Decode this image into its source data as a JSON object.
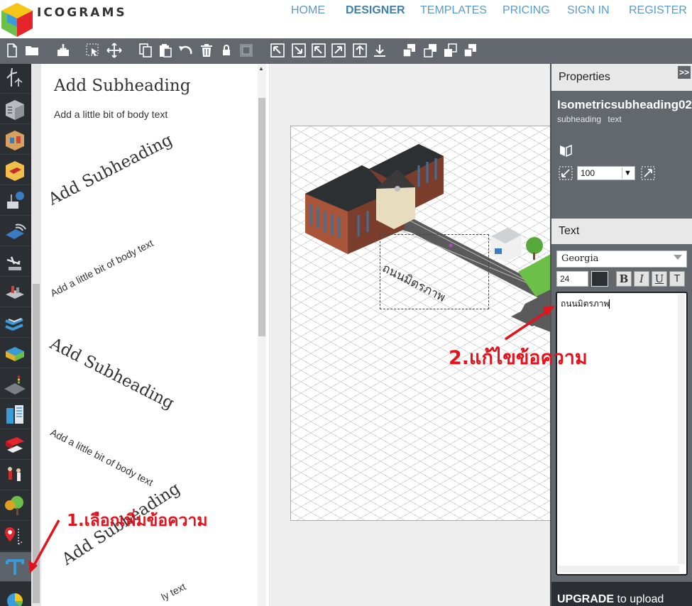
{
  "brand": {
    "name": "ICOGRAMS",
    "colors": [
      "#e5242b",
      "#f5c518",
      "#3a9bd9",
      "#6cc04a"
    ]
  },
  "nav": {
    "items": [
      {
        "label": "HOME",
        "active": false
      },
      {
        "label": "DESIGNER",
        "active": true
      },
      {
        "label": "TEMPLATES",
        "active": false
      },
      {
        "label": "PRICING",
        "active": false
      },
      {
        "label": "SIGN IN",
        "active": false
      },
      {
        "label": "REGISTER",
        "active": false
      }
    ],
    "link_color": "#5a9ac8"
  },
  "toolbar": {
    "icons": [
      "new-file-icon",
      "open-folder-icon",
      "save-icon",
      "select-icon",
      "pan-icon",
      "copy-icon",
      "paste-icon",
      "undo-icon",
      "delete-icon",
      "lock-icon",
      "group-icon",
      "align-top-left-icon",
      "align-bottom-right-icon",
      "align-top-left-corner-icon",
      "align-top-right-icon",
      "move-up-icon",
      "move-down-icon",
      "bring-front-icon",
      "send-back-icon",
      "bring-forward-icon",
      "send-backward-icon"
    ]
  },
  "categories": [
    "wind-turbine-icon",
    "building-icon",
    "office-room-icon",
    "bedroom-icon",
    "lab-icon",
    "wifi-icon",
    "airport-icon",
    "factory-icon",
    "boats-icon",
    "isometric-block-icon",
    "traffic-light-icon",
    "city-block-icon",
    "vehicles-icon",
    "people-icon",
    "trees-icon",
    "map-pin-icon",
    "text-icon",
    "pie-chart-icon"
  ],
  "templates": {
    "samples": [
      "Add Subheading",
      "Add a little bit of body text",
      "Add Subheading",
      "Add a little bit of body text",
      "Add Subheading",
      "Add a little bit of body text",
      "Add Subheading",
      "ly text"
    ]
  },
  "canvas": {
    "selected_text": "ถนนมิตรภาพ"
  },
  "properties": {
    "title": "Properties",
    "collapse_label": ">>",
    "object_name": "Isometricsubheading02",
    "object_tags": "subheading text",
    "zoom": "100"
  },
  "text_panel": {
    "title": "Text",
    "font": "Georgia",
    "size": "24",
    "color": "#2d3032",
    "bold": "B",
    "italic": "I",
    "underline": "U",
    "transform": "T",
    "content": "ถนนมิตรภาพ"
  },
  "upgrade": {
    "bold": "UPGRADE",
    "rest": " to upload"
  },
  "annotations": {
    "step1": "1.เลือกเพิ่มข้อความ",
    "step2": "2.แก้ไขข้อความ",
    "color": "#e3121c"
  }
}
